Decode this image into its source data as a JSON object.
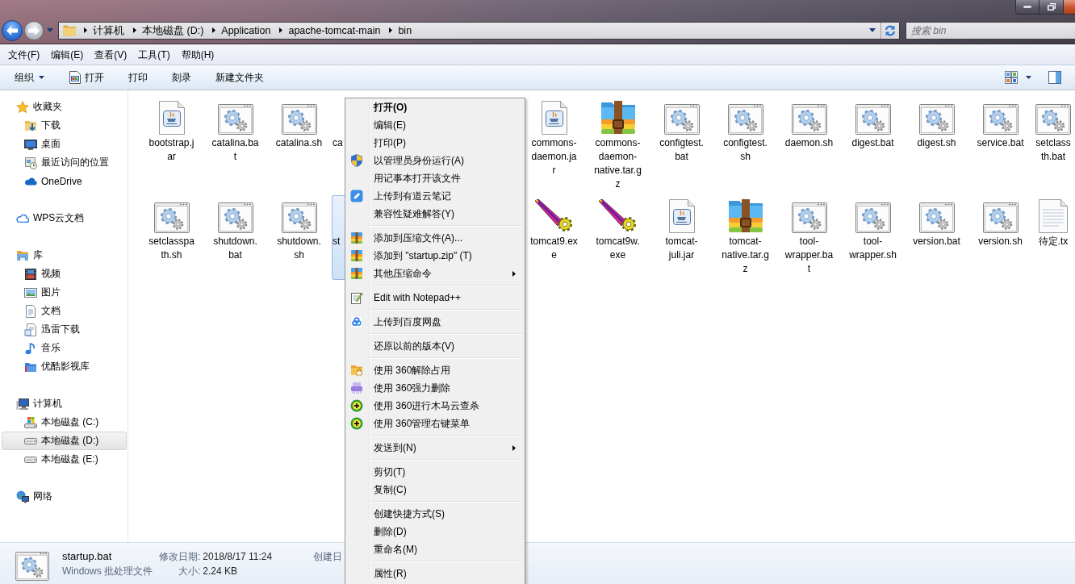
{
  "address_bar": {
    "breadcrumb": [
      "计算机",
      "本地磁盘 (D:)",
      "Application",
      "apache-tomcat-main",
      "bin"
    ]
  },
  "search": {
    "placeholder": "搜索 bin"
  },
  "menu_bar": {
    "items": [
      "文件(F)",
      "编辑(E)",
      "查看(V)",
      "工具(T)",
      "帮助(H)"
    ]
  },
  "toolbar": {
    "buttons": [
      {
        "label": "组织",
        "kind": "dropdown"
      },
      {
        "label": "打开",
        "kind": "open"
      },
      {
        "label": "打印",
        "kind": "plain"
      },
      {
        "label": "刻录",
        "kind": "plain"
      },
      {
        "label": "新建文件夹",
        "kind": "plain"
      }
    ]
  },
  "sidebar": {
    "items": [
      {
        "label": "收藏夹",
        "kind": "favorites",
        "selected": false,
        "children": [
          {
            "label": "下载",
            "kind": "downloads",
            "selected": false
          },
          {
            "label": "桌面",
            "kind": "desktop",
            "selected": false
          },
          {
            "label": "最近访问的位置",
            "kind": "recent",
            "selected": false
          },
          {
            "label": "OneDrive",
            "kind": "onedrive",
            "selected": false
          }
        ]
      },
      {
        "label": "WPS云文档",
        "kind": "wpscloud",
        "selected": false
      },
      {
        "label": "库",
        "kind": "library",
        "selected": false,
        "children": [
          {
            "label": "视频",
            "kind": "video",
            "selected": false
          },
          {
            "label": "图片",
            "kind": "pictures",
            "selected": false
          },
          {
            "label": "文档",
            "kind": "documents",
            "selected": false
          },
          {
            "label": "迅雷下载",
            "kind": "thunder",
            "selected": false
          },
          {
            "label": "音乐",
            "kind": "music",
            "selected": false
          },
          {
            "label": "优酷影视库",
            "kind": "youku",
            "selected": false
          }
        ]
      },
      {
        "label": "计算机",
        "kind": "computer",
        "selected": false,
        "children": [
          {
            "label": "本地磁盘 (C:)",
            "kind": "systemdrive",
            "selected": false
          },
          {
            "label": "本地磁盘 (D:)",
            "kind": "drive",
            "selected": true
          },
          {
            "label": "本地磁盘 (E:)",
            "kind": "drive",
            "selected": false
          }
        ]
      },
      {
        "label": "网络",
        "kind": "network",
        "selected": false
      }
    ]
  },
  "file_view": {
    "rows": [
      [
        {
          "name": "bootstrap.jar",
          "kind": "jar",
          "selected": false
        },
        {
          "name": "catalina.bat",
          "kind": "batch",
          "selected": false
        },
        {
          "name": "catalina.sh",
          "kind": "batch",
          "selected": false
        },
        {
          "name": "ca",
          "kind": "partial",
          "selected": false
        },
        {
          "name": "commons-daemon.jar",
          "kind": "jar",
          "selected": false
        },
        {
          "name": "commons-daemon-native.tar.gz",
          "kind": "archive",
          "selected": false
        },
        {
          "name": "configtest.bat",
          "kind": "batch",
          "selected": false
        },
        {
          "name": "configtest.sh",
          "kind": "batch",
          "selected": false
        },
        {
          "name": "daemon.sh",
          "kind": "batch",
          "selected": false
        },
        {
          "name": "digest.bat",
          "kind": "batch",
          "selected": false
        },
        {
          "name": "digest.sh",
          "kind": "batch",
          "selected": false
        },
        {
          "name": "service.bat",
          "kind": "batch",
          "selected": false
        },
        {
          "name": "setclass\nth.bat",
          "kind": "batch",
          "selected": false
        }
      ],
      [
        {
          "name": "setclasspath.sh",
          "kind": "batch",
          "selected": false
        },
        {
          "name": "shutdown.bat",
          "kind": "batch",
          "selected": false
        },
        {
          "name": "shutdown.sh",
          "kind": "batch",
          "selected": false
        },
        {
          "name": "st",
          "kind": "partial",
          "selected": true
        },
        {
          "name": "tomcat9.exe",
          "kind": "exe",
          "selected": false
        },
        {
          "name": "tomcat9w.exe",
          "kind": "exe",
          "selected": false
        },
        {
          "name": "tomcat-juli.jar",
          "kind": "jar",
          "selected": false
        },
        {
          "name": "tomcat-native.tar.gz",
          "kind": "archive",
          "selected": false
        },
        {
          "name": "tool-wrapper.bat",
          "kind": "batch",
          "selected": false
        },
        {
          "name": "tool-wrapper.sh",
          "kind": "batch",
          "selected": false
        },
        {
          "name": "version.bat",
          "kind": "batch",
          "selected": false
        },
        {
          "name": "version.sh",
          "kind": "batch",
          "selected": false
        },
        {
          "name": "待定.tx",
          "kind": "text",
          "selected": false
        }
      ]
    ]
  },
  "context_menu": {
    "groups": [
      [
        {
          "label": "打开(O)",
          "kind": "plain",
          "default": true,
          "submenu": false
        },
        {
          "label": "编辑(E)",
          "kind": "plain",
          "default": false,
          "submenu": false
        },
        {
          "label": "打印(P)",
          "kind": "plain",
          "default": false,
          "submenu": false
        },
        {
          "label": "以管理员身份运行(A)",
          "kind": "uac",
          "default": false,
          "submenu": false
        },
        {
          "label": "用记事本打开该文件",
          "kind": "plain",
          "default": false,
          "submenu": false
        },
        {
          "label": "上传到有道云笔记",
          "kind": "youdao",
          "default": false,
          "submenu": false
        },
        {
          "label": "兼容性疑难解答(Y)",
          "kind": "plain",
          "default": false,
          "submenu": false
        }
      ],
      [
        {
          "label": "添加到压缩文件(A)...",
          "kind": "archive",
          "default": false,
          "submenu": false
        },
        {
          "label": "添加到 \"startup.zip\" (T)",
          "kind": "archive",
          "default": false,
          "submenu": false
        },
        {
          "label": "其他压缩命令",
          "kind": "archive",
          "default": false,
          "submenu": true
        }
      ],
      [
        {
          "label": "Edit with Notepad++",
          "kind": "notepad",
          "default": false,
          "submenu": false
        }
      ],
      [
        {
          "label": "上传到百度网盘",
          "kind": "baidu",
          "default": false,
          "submenu": false
        }
      ],
      [
        {
          "label": "还原以前的版本(V)",
          "kind": "plain",
          "default": false,
          "submenu": false
        }
      ],
      [
        {
          "label": "使用 360解除占用",
          "kind": "unlock",
          "default": false,
          "submenu": false
        },
        {
          "label": "使用 360强力删除",
          "kind": "shred",
          "default": false,
          "submenu": false
        },
        {
          "label": "使用 360进行木马云查杀",
          "kind": "scan",
          "default": false,
          "submenu": false
        },
        {
          "label": "使用 360管理右键菜单",
          "kind": "scan",
          "default": false,
          "submenu": false
        }
      ],
      [
        {
          "label": "发送到(N)",
          "kind": "plain",
          "default": false,
          "submenu": true
        }
      ],
      [
        {
          "label": "剪切(T)",
          "kind": "plain",
          "default": false,
          "submenu": false
        },
        {
          "label": "复制(C)",
          "kind": "plain",
          "default": false,
          "submenu": false
        }
      ],
      [
        {
          "label": "创建快捷方式(S)",
          "kind": "plain",
          "default": false,
          "submenu": false
        },
        {
          "label": "删除(D)",
          "kind": "plain",
          "default": false,
          "submenu": false
        },
        {
          "label": "重命名(M)",
          "kind": "plain",
          "default": false,
          "submenu": false
        }
      ],
      [
        {
          "label": "属性(R)",
          "kind": "plain",
          "default": false,
          "submenu": false
        }
      ]
    ]
  },
  "details_pane": {
    "name": "startup.bat",
    "kind": "batch",
    "type": "Windows 批处理文件",
    "fields": [
      {
        "label": "修改日期:",
        "value": "2018/8/17 11:24"
      },
      {
        "label": "大小:",
        "value": "2.24 KB"
      },
      {
        "label": "创建日"
      }
    ]
  }
}
